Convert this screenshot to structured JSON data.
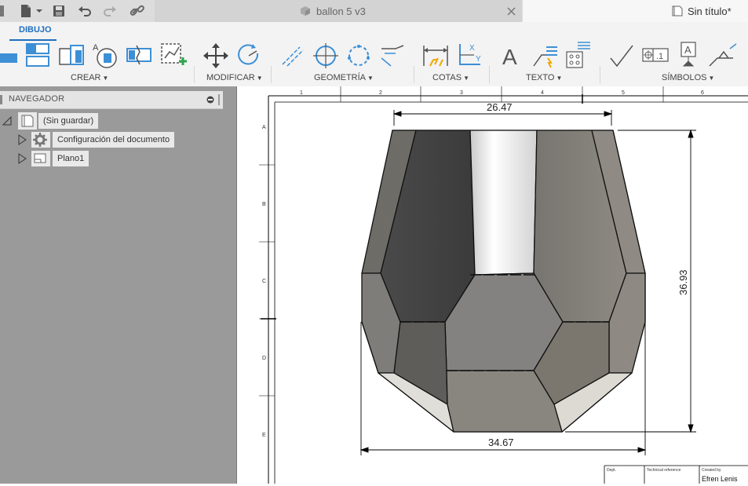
{
  "titlebar": {
    "tabs": [
      {
        "label": "ballon 5 v3",
        "active": false
      },
      {
        "label": "Sin título*",
        "active": true
      }
    ]
  },
  "ribbon": {
    "workspace": "DIBUJO",
    "groups": [
      {
        "label": "CREAR"
      },
      {
        "label": "MODIFICAR"
      },
      {
        "label": "GEOMETRÍA"
      },
      {
        "label": "COTAS"
      },
      {
        "label": "TEXTO"
      },
      {
        "label": "SÍMBOLOS"
      }
    ]
  },
  "navigator": {
    "title": "NAVEGADOR",
    "root": "(Sin guardar)",
    "children": [
      "Configuración del documento",
      "Plano1"
    ]
  },
  "drawing": {
    "column_labels": [
      "1",
      "2",
      "3",
      "4",
      "5",
      "6"
    ],
    "row_labels": [
      "A",
      "B",
      "C",
      "D",
      "E"
    ],
    "dimensions": {
      "top_width": "26.47",
      "bottom_width": "34.67",
      "height": "36.93"
    },
    "title_block": {
      "dept_label": "Dept.",
      "technical_reference_label": "Technical reference",
      "created_by_label": "Created by",
      "created_by_value": "Efren Lenis"
    }
  },
  "colors": {
    "accent": "#1e6fbf",
    "navigator_bg": "#9a9a9a",
    "canvas_bg": "#ffffff"
  }
}
